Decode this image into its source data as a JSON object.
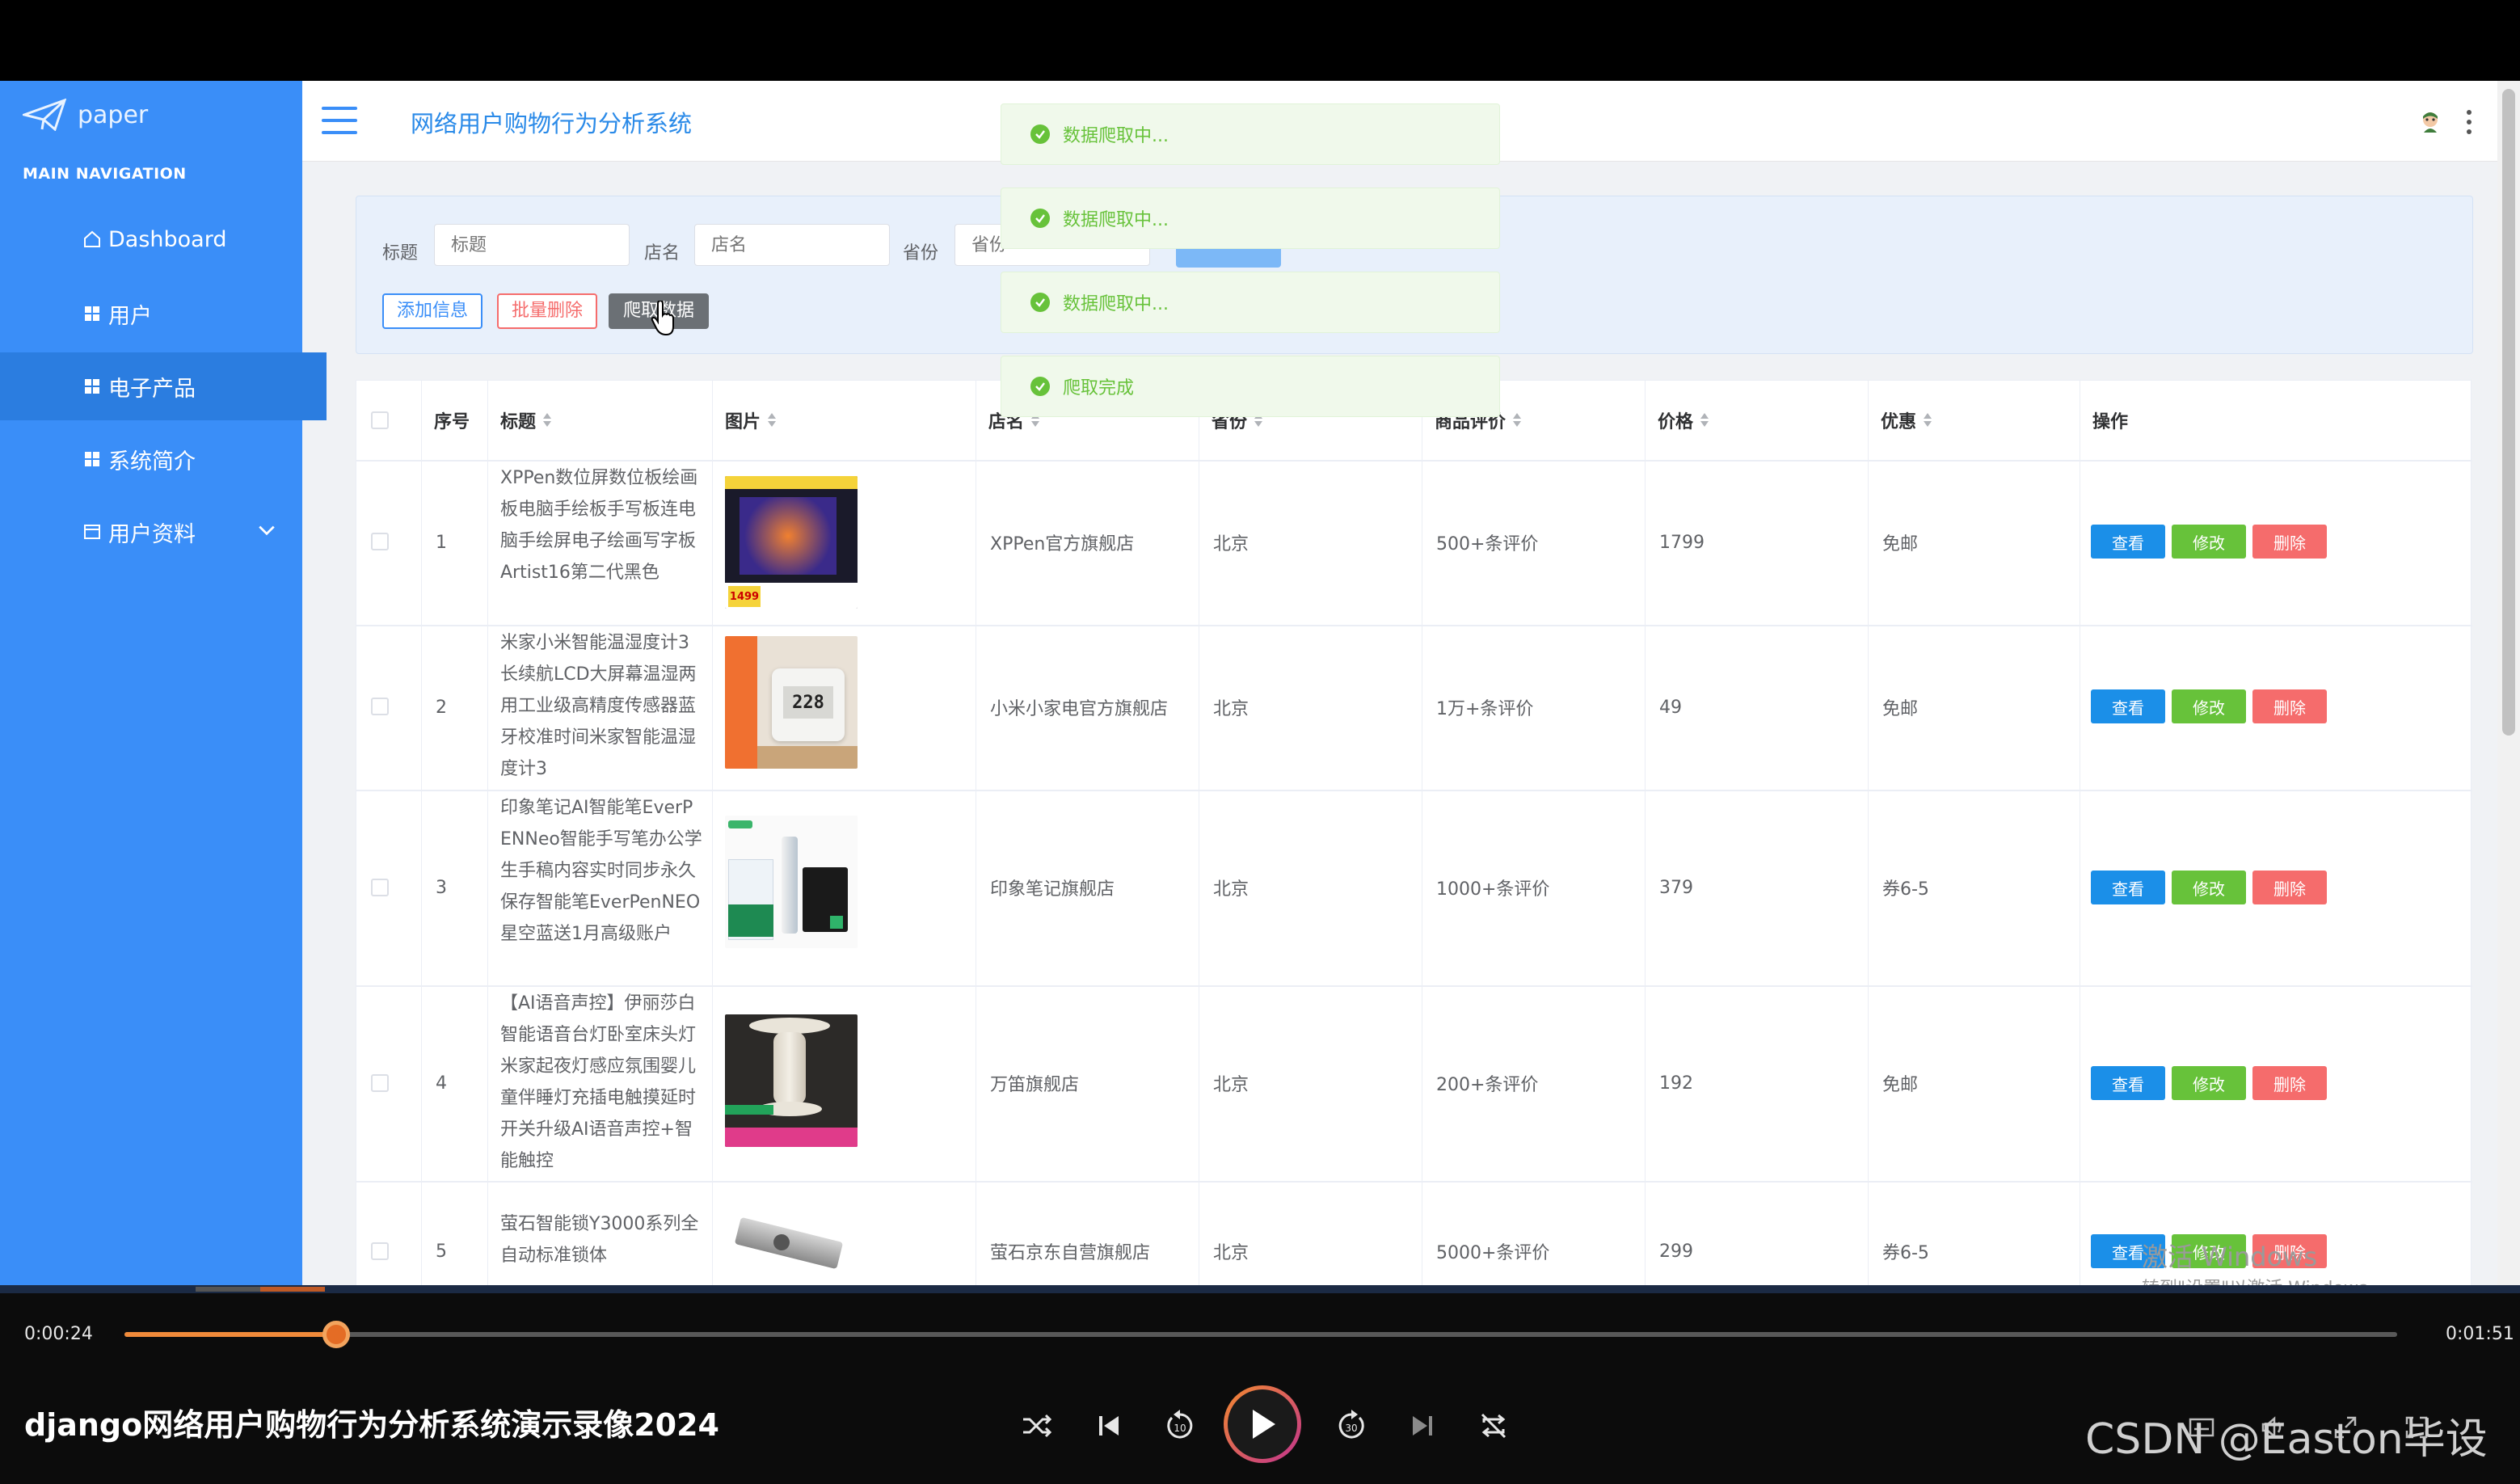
{
  "app": {
    "logo_text": "paper",
    "title": "网络用户购物行为分析系统",
    "main_nav_label": "MAIN NAVIGATION"
  },
  "sidebar": {
    "items": [
      {
        "label": "Dashboard",
        "icon": "home-icon"
      },
      {
        "label": "用户",
        "icon": "grid-icon"
      },
      {
        "label": "电子产品",
        "icon": "grid-icon",
        "active": true
      },
      {
        "label": "系统简介",
        "icon": "grid-icon"
      },
      {
        "label": "用户资料",
        "icon": "card-icon",
        "expandable": true
      }
    ]
  },
  "search": {
    "title_label": "标题",
    "title_placeholder": "标题",
    "shop_label": "店名",
    "shop_placeholder": "店名",
    "province_label": "省份",
    "province_placeholder": "省份"
  },
  "actions": {
    "add_label": "添加信息",
    "batch_delete_label": "批量删除",
    "crawl_label": "爬取数据"
  },
  "toasts": [
    {
      "text": "数据爬取中..."
    },
    {
      "text": "数据爬取中..."
    },
    {
      "text": "数据爬取中..."
    },
    {
      "text": "爬取完成"
    }
  ],
  "table": {
    "columns": [
      "序号",
      "标题",
      "图片",
      "店名",
      "省份",
      "商品评价",
      "价格",
      "优惠",
      "操作"
    ],
    "op_labels": {
      "view": "查看",
      "edit": "修改",
      "delete": "删除"
    },
    "rows": [
      {
        "index": "1",
        "title": "XPPen数位屏数位板绘画板电脑手绘板手写板连电脑手绘屏电子绘画写字板Artist16第二代黑色",
        "shop": "XPPen官方旗舰店",
        "province": "北京",
        "reviews": "500+条评价",
        "price": "1799",
        "discount": "免邮"
      },
      {
        "index": "2",
        "title": "米家小米智能温湿度计3长续航LCD大屏幕温湿两用工业级高精度传感器蓝牙校准时间米家智能温湿度计3",
        "shop": "小米小家电官方旗舰店",
        "province": "北京",
        "reviews": "1万+条评价",
        "price": "49",
        "discount": "免邮"
      },
      {
        "index": "3",
        "title": "印象笔记AI智能笔EverPENNeo智能手写笔办公学生手稿内容实时同步永久保存智能笔EverPenNEO星空蓝送1月高级账户",
        "shop": "印象笔记旗舰店",
        "province": "北京",
        "reviews": "1000+条评价",
        "price": "379",
        "discount": "券6-5"
      },
      {
        "index": "4",
        "title": "【AI语音声控】伊丽莎白智能语音台灯卧室床头灯米家起夜灯感应氛围婴儿童伴睡灯充插电触摸延时开关升级AI语音声控+智能触控",
        "shop": "万笛旗舰店",
        "province": "北京",
        "reviews": "200+条评价",
        "price": "192",
        "discount": "免邮"
      },
      {
        "index": "5",
        "title": "萤石智能锁Y3000系列全自动标准锁体",
        "shop": "萤石京东自营旗舰店",
        "province": "北京",
        "reviews": "5000+条评价",
        "price": "299",
        "discount": "券6-5"
      }
    ],
    "image_texts": {
      "row1_price": "1499",
      "row2_display": "228"
    }
  },
  "watermark": {
    "line1": "激活 Windows",
    "line2": "转到\"设置\"以激活 Windows。"
  },
  "player": {
    "current_time": "0:00:24",
    "total_time": "0:01:51",
    "progress": 0.093,
    "video_title": "django网络用户购物行为分析系统演示录像2024",
    "skip_back_label": "10",
    "skip_forward_label": "30",
    "csdn_label": "CSDN @Easton毕设"
  },
  "colors": {
    "sidebar": "#3a8ef8",
    "accent": "#2a8ae8",
    "success": "#67c23a",
    "danger": "#f56c6c",
    "progress": "#f08a3a"
  }
}
